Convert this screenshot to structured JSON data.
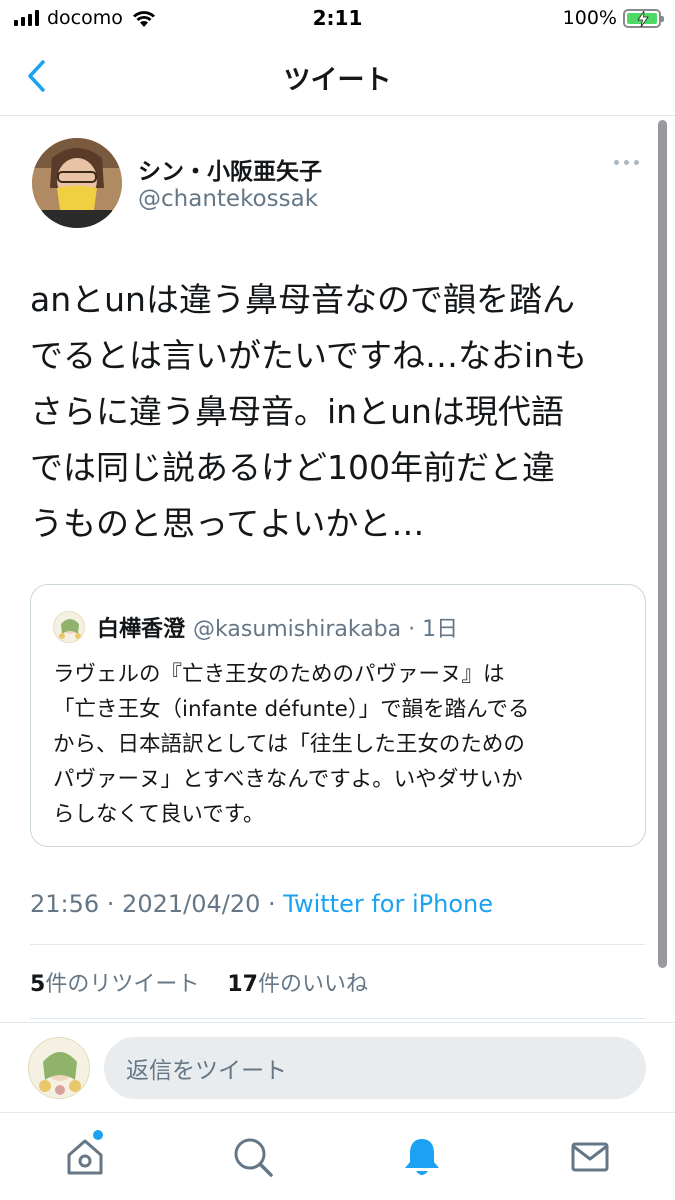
{
  "status_bar": {
    "carrier": "docomo",
    "time": "2:11",
    "battery": "100%",
    "battery_level": 1.0
  },
  "nav": {
    "title": "ツイート"
  },
  "tweet": {
    "author_name": "シン・小阪亜矢子",
    "author_handle": "@chantekossak",
    "text_lines": [
      "anとunは違う鼻母音なので韻を踏ん",
      "でるとは言いがたいですね…なおinも",
      "さらに違う鼻母音。inとunは現代語",
      "では同じ説あるけど100年前だと違",
      "うものと思ってよいかと…"
    ],
    "timestamp": "21:56 · 2021/04/20 · ",
    "source": "Twitter for iPhone",
    "retweet_count": "5",
    "retweet_label": "件のリツイート",
    "like_count": "17",
    "like_label": "件のいいね"
  },
  "quote": {
    "name": "白樺香澄",
    "handle": "@kasumishirakaba · 1日",
    "text_lines": [
      "ラヴェルの『亡き王女のためのパヴァーヌ』は",
      "「亡き王女（infante défunte）」で韻を踏んでる",
      "から、日本語訳としては「往生した王女のための",
      "パヴァーヌ」とすべきなんですよ。いやダサいか",
      "らしなくて良いです。"
    ]
  },
  "reply": {
    "placeholder": "返信をツイート"
  },
  "tabs": [
    {
      "name": "home",
      "icon": "home-icon",
      "has_notification_dot": true
    },
    {
      "name": "search",
      "icon": "search-icon"
    },
    {
      "name": "notifications",
      "icon": "bell-icon",
      "active": true
    },
    {
      "name": "messages",
      "icon": "mail-icon"
    }
  ],
  "colors": {
    "accent": "#1da1f2",
    "text": "#14171a",
    "secondary": "#657786",
    "battery_green": "#4cd964"
  }
}
